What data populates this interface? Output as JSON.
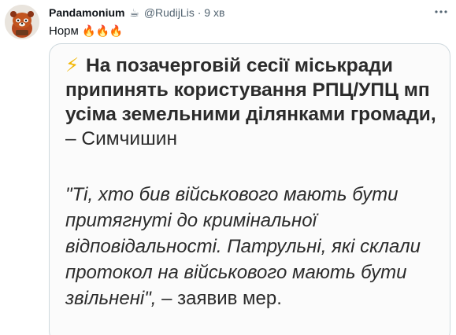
{
  "tweet": {
    "display_name": "Pandamonium",
    "name_emoji": "☕",
    "handle": "@RudijLis",
    "separator": "·",
    "time": "9 хв",
    "text": "Норм",
    "text_emoji": "🔥🔥🔥",
    "more_icon": "more-horizontal-icon"
  },
  "card": {
    "lightning": "⚡",
    "headline_bold": "На позачерговій сесії міськради припинять користування РПЦ/УПЦ мп усіма земельними ділянками громади,",
    "headline_rest": " – Симчишин",
    "quote_italic": "\"Ті, хто бив військового мають бути притягнуті до кримінальної відповідальності. Патрульні, які склали протокол на військового мають бути звільнені\",",
    "quote_rest": " – заявив мер."
  },
  "colors": {
    "lightning": "#f2b705",
    "text": "#0f1419",
    "secondary": "#536471",
    "card_text": "#2b2b2b"
  }
}
